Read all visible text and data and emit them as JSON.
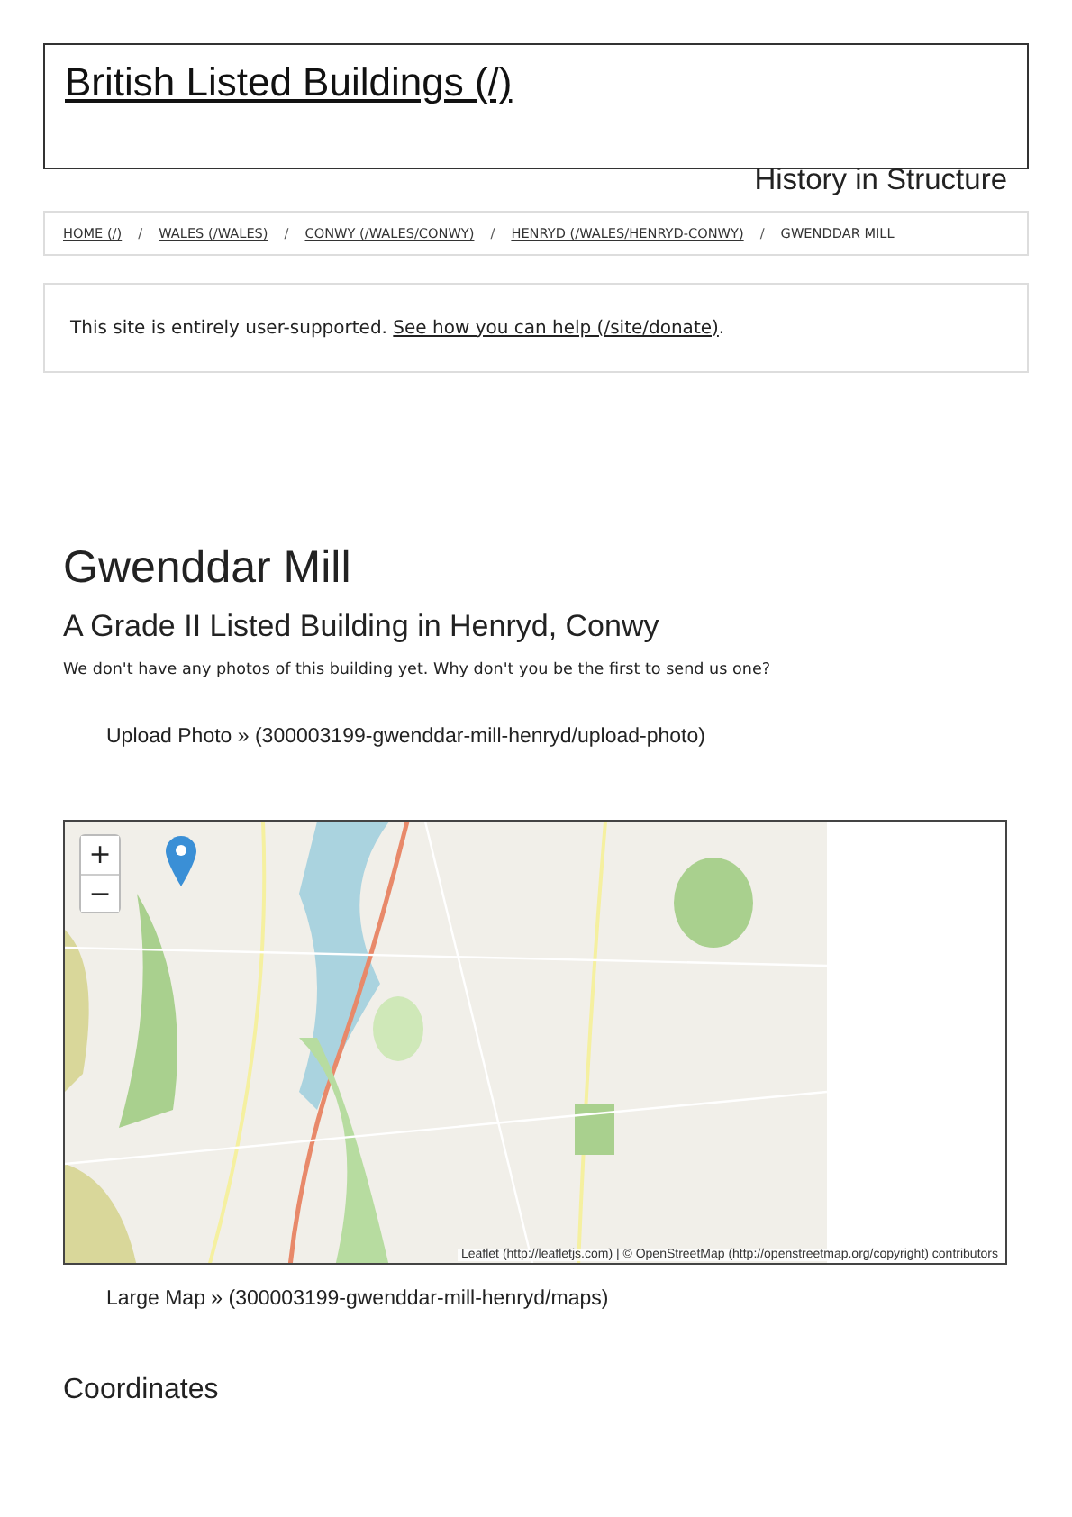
{
  "site_title": "British Listed Buildings (/)",
  "tagline": "History in Structure",
  "breadcrumbs": [
    {
      "label": "HOME (/)",
      "kind": "link"
    },
    {
      "label": "WALES (/WALES)",
      "kind": "link"
    },
    {
      "label": "CONWY (/WALES/CONWY)",
      "kind": "link"
    },
    {
      "label": "HENRYD (/WALES/HENRYD-CONWY)",
      "kind": "link"
    },
    {
      "label": "GWENDDAR MILL",
      "kind": "current"
    }
  ],
  "breadcrumb_separator": "/",
  "notice": {
    "text": "This site is entirely user-supported. ",
    "link": "See how you can help (/site/donate)",
    "after": "."
  },
  "heading": "Gwenddar Mill",
  "subheading": "A Grade II Listed Building in Henryd, Conwy",
  "photo_note": "We don't have any photos of this building yet. Why don't you be the first to send us one?",
  "upload_link": "Upload Photo » (300003199-gwenddar-mill-henryd/upload-photo)",
  "map": {
    "kind": "picture",
    "zoom_in": "+",
    "zoom_out": "−",
    "attribution": "Leaflet (http://leafletjs.com) | © OpenStreetMap (http://openstreetmap.org/copyright) contributors"
  },
  "large_map_link": "Large Map » (300003199-gwenddar-mill-henryd/maps)",
  "section_heading": "Coordinates"
}
